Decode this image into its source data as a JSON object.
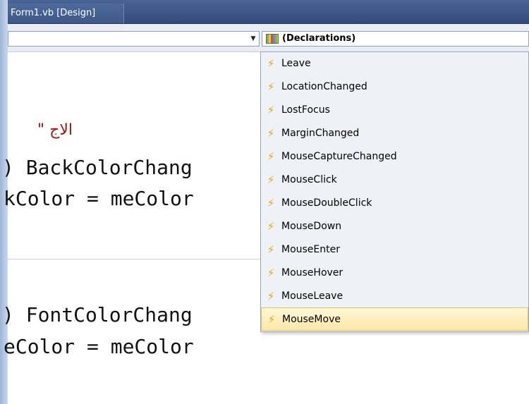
{
  "window": {
    "title": "Form1.vb [Design]"
  },
  "navigation": {
    "class_combo_value": "",
    "member_combo_value": "(Declarations)",
    "member_combo_icon": "declarations-icon"
  },
  "code": {
    "arabic_fragment": "\" الاج",
    "line1": ") BackColorChang",
    "line2": "kColor = meColor",
    "line3": ") FontColorChang",
    "line4": "eColor = meColor"
  },
  "dropdown": {
    "item_icon": "event-bolt-icon",
    "items": [
      "Leave",
      "LocationChanged",
      "LostFocus",
      "MarginChanged",
      "MouseCaptureChanged",
      "MouseClick",
      "MouseDoubleClick",
      "MouseDown",
      "MouseEnter",
      "MouseHover",
      "MouseLeave",
      "MouseMove"
    ],
    "selected": "MouseMove"
  },
  "colors": {
    "titlebar": "#3c5687",
    "selection_highlight": "#ffe8a8",
    "string_literal": "#a31515",
    "event_icon": "#e8a414"
  }
}
